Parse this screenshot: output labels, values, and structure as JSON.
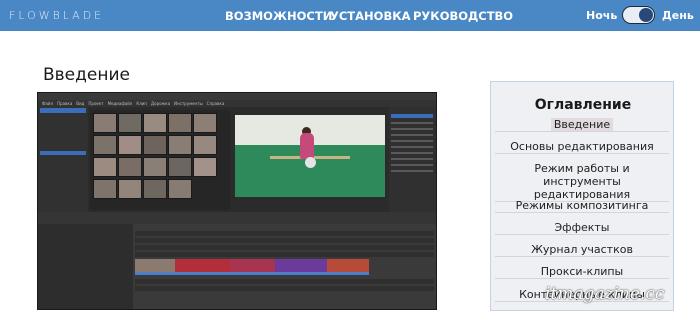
{
  "header": {
    "logo": "FLOWBLADE",
    "nav": [
      "ВОЗМОЖНОСТИ",
      "УСТАНОВКА",
      "РУКОВОДСТВО"
    ],
    "theme_night": "Ночь",
    "theme_day": "День",
    "toggle_state": "day"
  },
  "page": {
    "title": "Введение"
  },
  "app_screenshot": {
    "menu": [
      "Файл",
      "Правка",
      "Вид",
      "Проект",
      "Медиафайл",
      "Клип",
      "Дорожка",
      "Инструменты",
      "Справка"
    ]
  },
  "toc": {
    "title": "Оглавление",
    "items": [
      "Введение",
      "Основы редактирования",
      "Режим работы и инструменты редактирования",
      "Режимы композитинга",
      "Эффекты",
      "Журнал участков",
      "Прокси-клипы",
      "Контейнерные клипы"
    ],
    "active_index": 0
  },
  "watermark": "itmagazine.cc",
  "colors": {
    "header": "#4a87c5",
    "toc_bg": "#eef0f3",
    "active_bg": "#e2dadd"
  }
}
